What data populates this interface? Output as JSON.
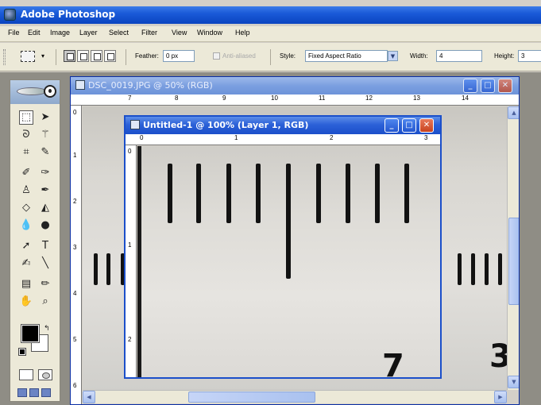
{
  "app": {
    "title": "Adobe Photoshop"
  },
  "menu": {
    "items": [
      "File",
      "Edit",
      "Image",
      "Layer",
      "Select",
      "Filter",
      "View",
      "Window",
      "Help"
    ]
  },
  "options": {
    "feather_label": "Feather:",
    "feather_value": "0 px",
    "antialiased_label": "Anti-aliased",
    "style_label": "Style:",
    "style_value": "Fixed Aspect Ratio",
    "width_label": "Width:",
    "width_value": "4",
    "height_label": "Height:",
    "height_value": "3"
  },
  "windows": {
    "background": {
      "title": "DSC_0019.JPG @ 50% (RGB)",
      "ruler_h": [
        "7",
        "8",
        "9",
        "10",
        "11",
        "12",
        "13",
        "14"
      ],
      "ruler_v": [
        "0",
        "1",
        "2",
        "3",
        "4",
        "5",
        "6"
      ]
    },
    "front": {
      "title": "Untitled-1 @ 100% (Layer 1, RGB)",
      "ruler_h": [
        "0",
        "1",
        "2",
        "3"
      ],
      "ruler_v": [
        "0",
        "1",
        "2"
      ],
      "visible_digit": "7"
    }
  },
  "background_photo": {
    "visible_digit": "3"
  },
  "icons": {
    "minimize": "minimize-icon",
    "maximize": "maximize-icon",
    "close": "close-icon"
  },
  "colors": {
    "title_bar": "#0a44c0",
    "doc_title_active": "#2c61d8",
    "close_button": "#c8421e",
    "foreground": "#000000",
    "background_swatch": "#ffffff"
  }
}
